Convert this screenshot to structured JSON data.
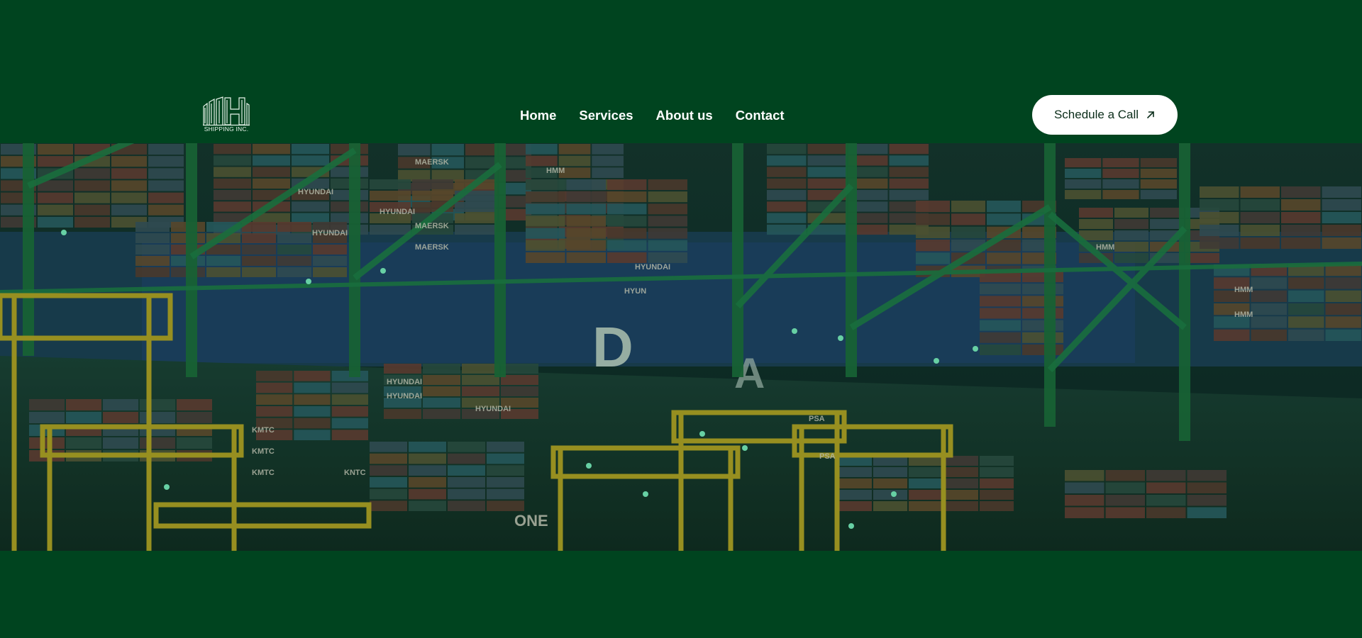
{
  "brand": {
    "logo_text": "SHIPPING INC.",
    "logo_icon": "building-logo-icon"
  },
  "nav": {
    "items": [
      {
        "label": "Home"
      },
      {
        "label": "Services"
      },
      {
        "label": "About us"
      },
      {
        "label": "Contact"
      }
    ]
  },
  "cta": {
    "label": "Schedule a Call",
    "icon": "arrow-up-right-icon"
  },
  "hero": {
    "image_subject": "container-port-at-night",
    "container_labels": [
      "MAERSK",
      "MAERSK",
      "MAERSK",
      "HMM",
      "HMM",
      "HMM",
      "HMM",
      "HYUNDAI",
      "HYUNDAI",
      "HYUNDAI",
      "HYUNDAI",
      "HYUNDAI",
      "HYUNDAI",
      "HYUNDAI",
      "HYUN",
      "KMTC",
      "KMTC",
      "KMTC",
      "KNTC",
      "ONE",
      "PSA",
      "PSA",
      "D",
      "A"
    ]
  },
  "colors": {
    "background": "#00441f",
    "cta_background": "#ffffff",
    "cta_text": "#0b2d1a",
    "nav_text": "#ffffff"
  }
}
